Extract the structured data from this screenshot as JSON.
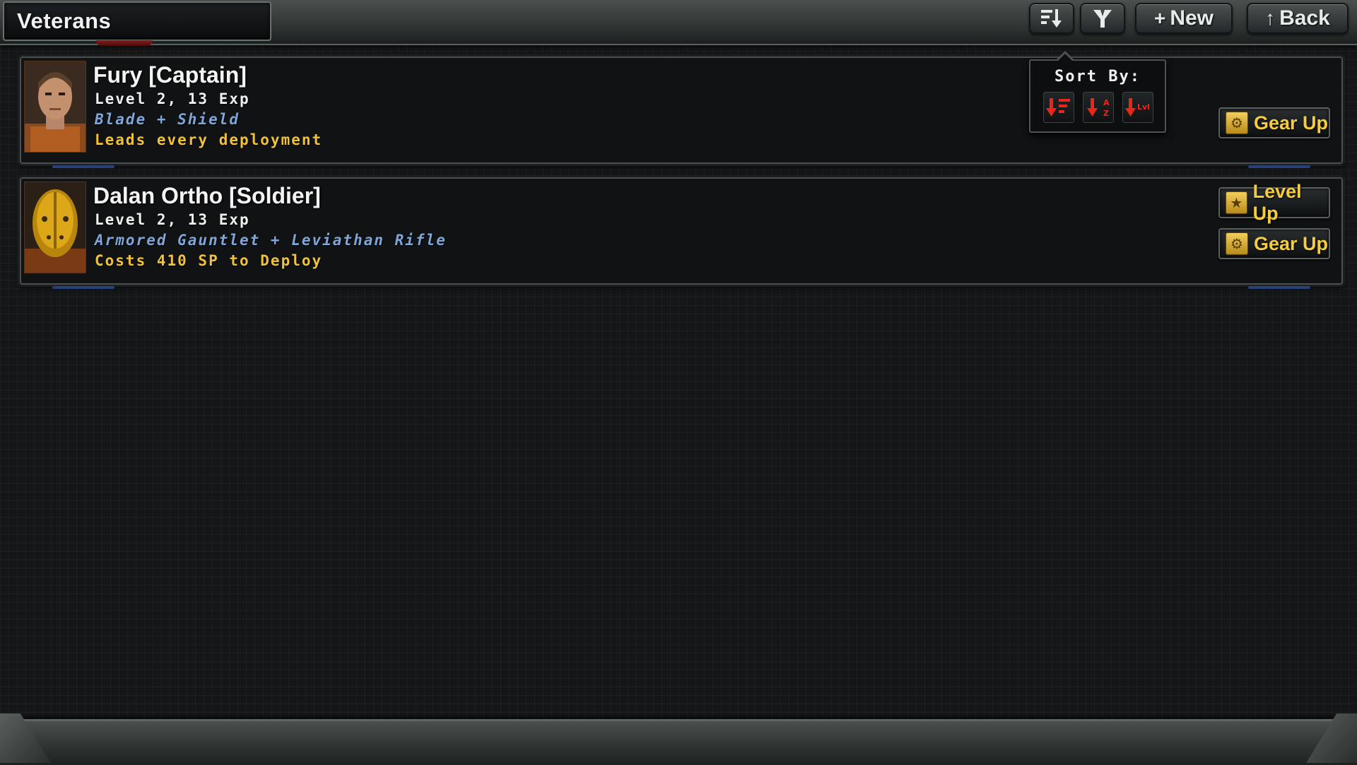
{
  "header": {
    "title": "Veterans",
    "new_label": "New",
    "back_label": "Back",
    "new_glyph": "+",
    "back_glyph": "↑"
  },
  "sort_popup": {
    "title": "Sort By:",
    "options": [
      {
        "icon": "sort-default-icon"
      },
      {
        "icon": "sort-alpha-icon",
        "text": "A Z"
      },
      {
        "icon": "sort-level-icon",
        "text": "Lvl"
      }
    ]
  },
  "veterans": [
    {
      "name": "Fury [Captain]",
      "level": "Level 2, 13 Exp",
      "gear": "Blade + Shield",
      "note": "Leads every deployment",
      "actions": [
        "Gear Up"
      ]
    },
    {
      "name": "Dalan Ortho [Soldier]",
      "level": "Level 2, 13 Exp",
      "gear": "Armored Gauntlet + Leviathan Rifle",
      "note": "Costs 410 SP to Deploy",
      "actions": [
        "Level Up",
        "Gear Up"
      ]
    }
  ],
  "colors": {
    "gear_text": "#7fa6d8",
    "note_text": "#f0c23a",
    "button_text": "#f4cc3e",
    "sort_icon": "#e8261a"
  }
}
